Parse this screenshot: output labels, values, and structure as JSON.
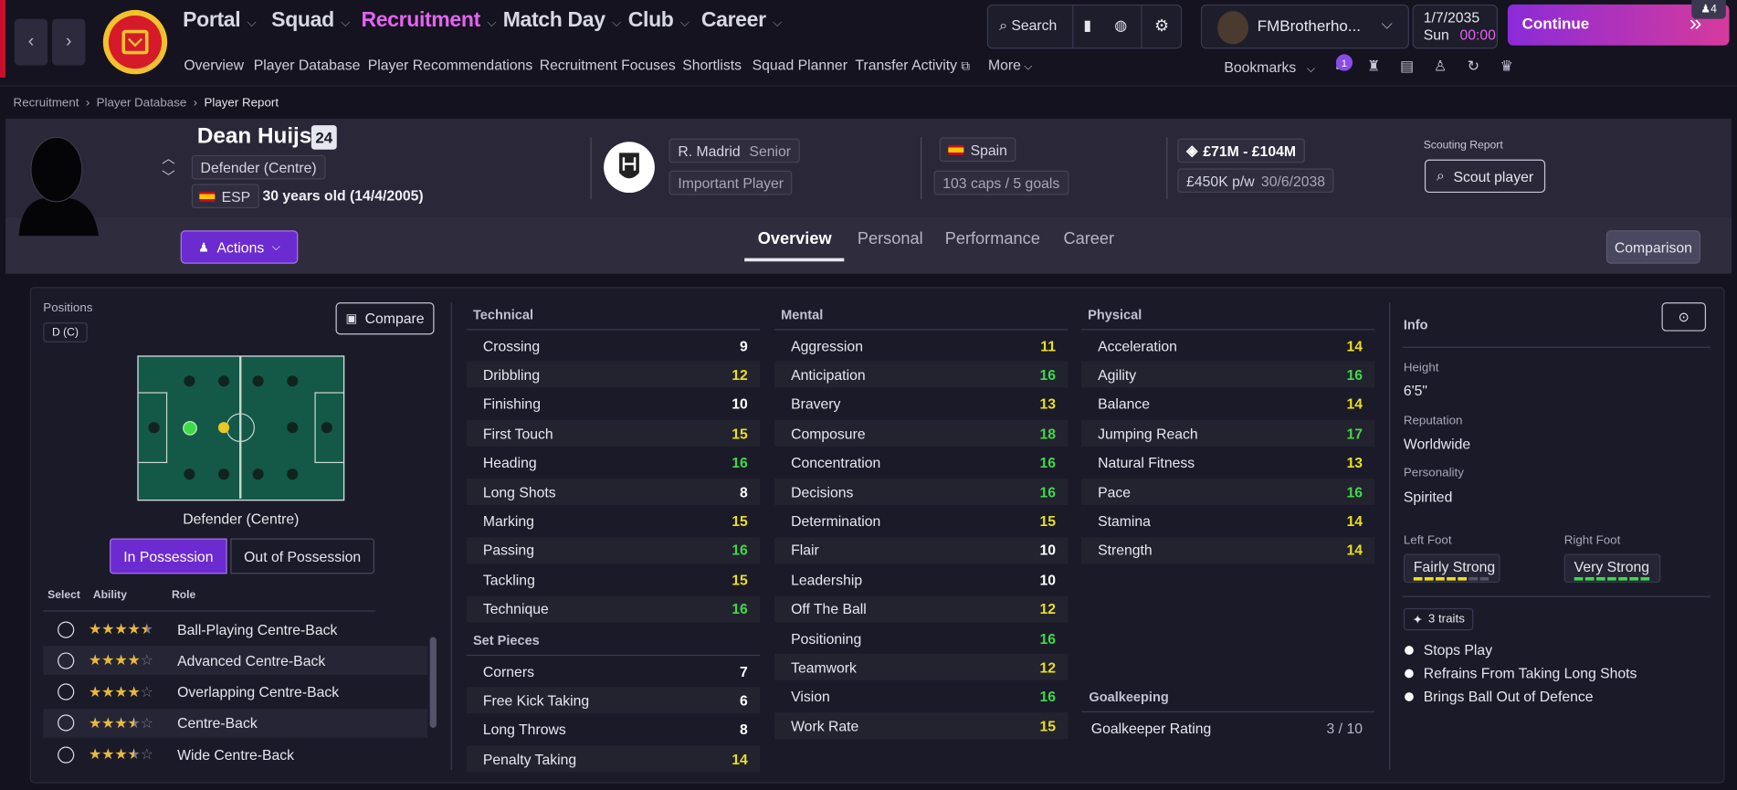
{
  "nav": {
    "menus": [
      "Portal",
      "Squad",
      "Recruitment",
      "Match Day",
      "Club",
      "Career"
    ],
    "submenu": [
      "Overview",
      "Player Database",
      "Player Recommendations",
      "Recruitment Focuses",
      "Shortlists",
      "Squad Planner",
      "Transfer Activity",
      "More"
    ],
    "search_label": "Search",
    "manager": "FMBrotherho...",
    "date": "1/7/2035",
    "day": "Sun",
    "time": "00:00",
    "continue": "Continue",
    "notif_count": "4",
    "bookmarks": "Bookmarks",
    "badge": "1"
  },
  "breadcrumb": [
    "Recruitment",
    "Player Database",
    "Player Report"
  ],
  "player": {
    "name": "Dean Huijsen",
    "number": "24",
    "position": "Defender (Centre)",
    "nation_code": "ESP",
    "age": "30 years old (14/4/2005)",
    "club": "R. Madrid",
    "squad": "Senior",
    "status": "Important Player",
    "nation": "Spain",
    "caps": "103 caps / 5 goals",
    "value": "£71M - £104M",
    "wage": "£450K p/w",
    "contract": "30/6/2038",
    "scouting_label": "Scouting Report",
    "scout_btn": "Scout player"
  },
  "actions": "Actions",
  "comparison": "Comparison",
  "tabs": [
    "Overview",
    "Personal",
    "Performance",
    "Career"
  ],
  "positions": {
    "label": "Positions",
    "code": "D (C)",
    "compare": "Compare",
    "caption": "Defender (Centre)",
    "in_poss": "In Possession",
    "out_poss": "Out of Possession",
    "col_select": "Select",
    "col_ability": "Ability",
    "col_role": "Role"
  },
  "roles": [
    {
      "name": "Ball-Playing Centre-Back",
      "stars": 4.5
    },
    {
      "name": "Advanced Centre-Back",
      "stars": 4
    },
    {
      "name": "Overlapping Centre-Back",
      "stars": 4
    },
    {
      "name": "Centre-Back",
      "stars": 3.5
    },
    {
      "name": "Wide Centre-Back",
      "stars": 3.5
    }
  ],
  "technical": {
    "label": "Technical",
    "items": [
      [
        "Crossing",
        "9"
      ],
      [
        "Dribbling",
        "12"
      ],
      [
        "Finishing",
        "10"
      ],
      [
        "First Touch",
        "15"
      ],
      [
        "Heading",
        "16"
      ],
      [
        "Long Shots",
        "8"
      ],
      [
        "Marking",
        "15"
      ],
      [
        "Passing",
        "16"
      ],
      [
        "Tackling",
        "15"
      ],
      [
        "Technique",
        "16"
      ]
    ]
  },
  "setpieces": {
    "label": "Set Pieces",
    "items": [
      [
        "Corners",
        "7"
      ],
      [
        "Free Kick Taking",
        "6"
      ],
      [
        "Long Throws",
        "8"
      ],
      [
        "Penalty Taking",
        "14"
      ]
    ]
  },
  "mental": {
    "label": "Mental",
    "items": [
      [
        "Aggression",
        "11"
      ],
      [
        "Anticipation",
        "16"
      ],
      [
        "Bravery",
        "13"
      ],
      [
        "Composure",
        "18"
      ],
      [
        "Concentration",
        "16"
      ],
      [
        "Decisions",
        "16"
      ],
      [
        "Determination",
        "15"
      ],
      [
        "Flair",
        "10"
      ],
      [
        "Leadership",
        "10"
      ],
      [
        "Off The Ball",
        "12"
      ],
      [
        "Positioning",
        "16"
      ],
      [
        "Teamwork",
        "12"
      ],
      [
        "Vision",
        "16"
      ],
      [
        "Work Rate",
        "15"
      ]
    ]
  },
  "physical": {
    "label": "Physical",
    "items": [
      [
        "Acceleration",
        "14"
      ],
      [
        "Agility",
        "16"
      ],
      [
        "Balance",
        "14"
      ],
      [
        "Jumping Reach",
        "17"
      ],
      [
        "Natural Fitness",
        "13"
      ],
      [
        "Pace",
        "16"
      ],
      [
        "Stamina",
        "14"
      ],
      [
        "Strength",
        "14"
      ]
    ]
  },
  "goalkeeping": {
    "label": "Goalkeeping",
    "rating_label": "Goalkeeper Rating",
    "rating": "3 / 10"
  },
  "info": {
    "title": "Info",
    "height_l": "Height",
    "height": "6'5\"",
    "rep_l": "Reputation",
    "rep": "Worldwide",
    "pers_l": "Personality",
    "pers": "Spirited",
    "lf_l": "Left Foot",
    "lf": "Fairly Strong",
    "lf_level": 5,
    "rf_l": "Right Foot",
    "rf": "Very Strong",
    "rf_level": 7,
    "traits_count": "3 traits",
    "traits": [
      "Stops Play",
      "Refrains From Taking Long Shots",
      "Brings Ball Out of Defence"
    ]
  },
  "colors": {
    "accent": "#7b2fd6",
    "white": "#ffffff",
    "yellow": "#e9df21",
    "green": "#3fd94a"
  }
}
